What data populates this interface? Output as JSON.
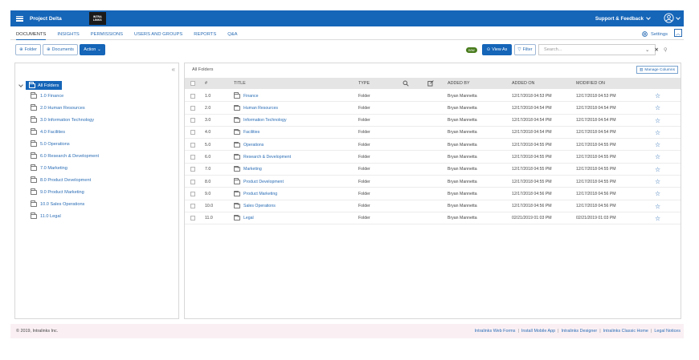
{
  "header": {
    "project_title": "Project Delta",
    "logo_line1": "INTRA",
    "logo_line2": "LINKS",
    "support_label": "Support & Feedback"
  },
  "nav": {
    "tabs": [
      {
        "label": "DOCUMENTS",
        "active": true
      },
      {
        "label": "INSIGHTS",
        "active": false
      },
      {
        "label": "PERMISSIONS",
        "active": false
      },
      {
        "label": "USERS AND GROUPS",
        "active": false
      },
      {
        "label": "REPORTS",
        "active": false
      },
      {
        "label": "Q&A",
        "active": false
      }
    ],
    "settings_label": "Settings"
  },
  "toolbar": {
    "folder_label": "Folder",
    "documents_label": "Documents",
    "action_label": "Action",
    "new_badge": "new",
    "view_as_label": "View As",
    "filter_label": "Filter",
    "search_placeholder": "Search..."
  },
  "tree": {
    "root_label": "All Folders",
    "items": [
      "1.0 Finance",
      "2.0 Human Resources",
      "3.0 Information Technology",
      "4.0 Facilities",
      "5.0 Operations",
      "6.0 Research & Development",
      "7.0 Marketing",
      "8.0 Product Development",
      "9.0 Product Marketing",
      "10.0 Sales Operations",
      "11.0 Legal"
    ]
  },
  "table": {
    "breadcrumb": "All Folders",
    "manage_columns_label": "Manage Columns",
    "headers": {
      "num": "#",
      "title": "TITLE",
      "type": "TYPE",
      "added_by": "ADDED BY",
      "added_on": "ADDED ON",
      "modified_on": "MODIFIED ON"
    },
    "rows": [
      {
        "num": "1.0",
        "title": "Finance",
        "type": "Folder",
        "added_by": "Bryan Mannetta",
        "added_on": "12/17/2018 04:53 PM",
        "modified_on": "12/17/2018 04:53 PM"
      },
      {
        "num": "2.0",
        "title": "Human Resources",
        "type": "Folder",
        "added_by": "Bryan Mannetta",
        "added_on": "12/17/2018 04:54 PM",
        "modified_on": "12/17/2018 04:54 PM"
      },
      {
        "num": "3.0",
        "title": "Information Technology",
        "type": "Folder",
        "added_by": "Bryan Mannetta",
        "added_on": "12/17/2018 04:54 PM",
        "modified_on": "12/17/2018 04:54 PM"
      },
      {
        "num": "4.0",
        "title": "Facilities",
        "type": "Folder",
        "added_by": "Bryan Mannetta",
        "added_on": "12/17/2018 04:54 PM",
        "modified_on": "12/17/2018 04:54 PM"
      },
      {
        "num": "5.0",
        "title": "Operations",
        "type": "Folder",
        "added_by": "Bryan Mannetta",
        "added_on": "12/17/2018 04:55 PM",
        "modified_on": "12/17/2018 04:55 PM"
      },
      {
        "num": "6.0",
        "title": "Research & Development",
        "type": "Folder",
        "added_by": "Bryan Mannetta",
        "added_on": "12/17/2018 04:55 PM",
        "modified_on": "12/17/2018 04:55 PM"
      },
      {
        "num": "7.0",
        "title": "Marketing",
        "type": "Folder",
        "added_by": "Bryan Mannetta",
        "added_on": "12/17/2018 04:55 PM",
        "modified_on": "12/17/2018 04:55 PM"
      },
      {
        "num": "8.0",
        "title": "Product Development",
        "type": "Folder",
        "added_by": "Bryan Mannetta",
        "added_on": "12/17/2018 04:55 PM",
        "modified_on": "12/17/2018 04:55 PM"
      },
      {
        "num": "9.0",
        "title": "Product Marketing",
        "type": "Folder",
        "added_by": "Bryan Mannetta",
        "added_on": "12/17/2018 04:56 PM",
        "modified_on": "12/17/2018 04:56 PM"
      },
      {
        "num": "10.0",
        "title": "Sales Operations",
        "type": "Folder",
        "added_by": "Bryan Mannetta",
        "added_on": "12/17/2018 04:56 PM",
        "modified_on": "12/17/2018 04:56 PM"
      },
      {
        "num": "11.0",
        "title": "Legal",
        "type": "Folder",
        "added_by": "Bryan Mannetta",
        "added_on": "02/21/2019 01:03 PM",
        "modified_on": "02/21/2019 01:03 PM"
      }
    ]
  },
  "footer": {
    "copyright": "© 2019, Intralinks Inc.",
    "links": [
      "Intralinks Web Forms",
      "Install Mobile App",
      "Intralinks Designer",
      "Intralinks Classic Home",
      "Legal Notices"
    ]
  },
  "colors": {
    "primary": "#1565b8",
    "link": "#2a6db5",
    "new_badge": "#4a7d1e",
    "footer_bg": "#faf0f4"
  }
}
